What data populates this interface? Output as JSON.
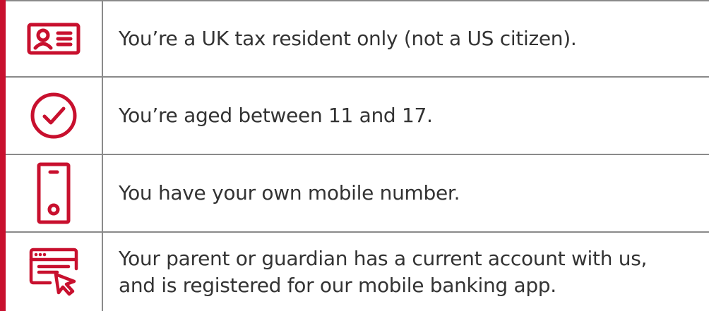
{
  "colors": {
    "accent": "#c8102e",
    "border": "#8a8a8a",
    "text": "#333333"
  },
  "rows": [
    {
      "icon": "id-card-icon",
      "text": "You’re a UK tax resident only (not a US citizen)."
    },
    {
      "icon": "check-circle-icon",
      "text": "You’re aged between 11 and 17."
    },
    {
      "icon": "mobile-phone-icon",
      "text": "You have your own mobile number."
    },
    {
      "icon": "browser-click-icon",
      "text_line1": "Your parent or guardian has a current account with us,",
      "text_line2": "and is registered for our mobile banking app."
    }
  ]
}
